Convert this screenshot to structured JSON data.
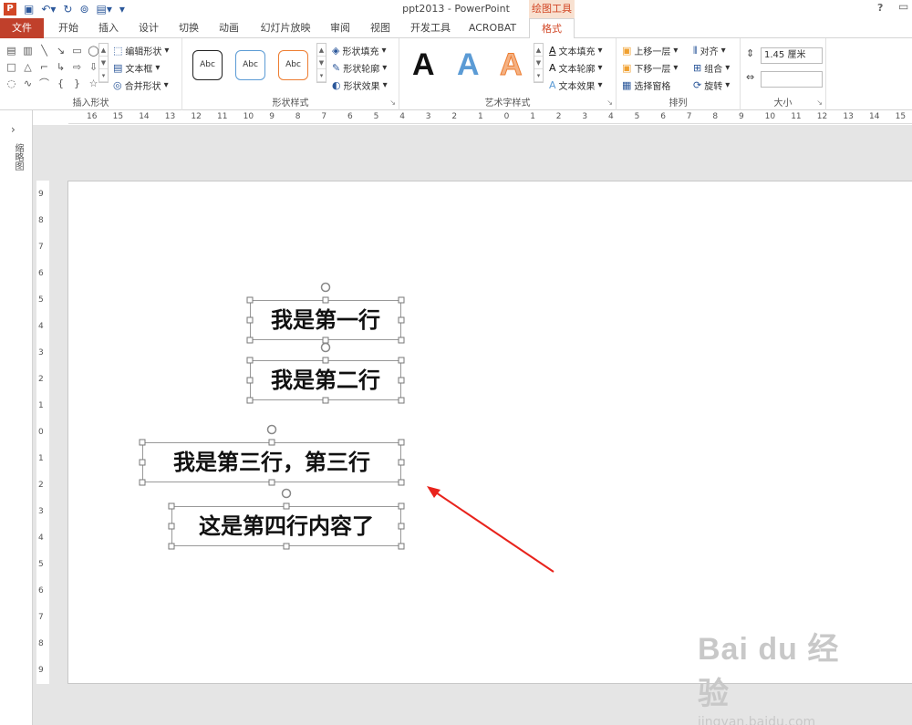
{
  "title": "ppt2013 - PowerPoint",
  "context_group": "绘图工具",
  "help": "?",
  "tabs": [
    "文件",
    "开始",
    "插入",
    "设计",
    "切换",
    "动画",
    "幻灯片放映",
    "审阅",
    "视图",
    "开发工具",
    "ACROBAT",
    "格式"
  ],
  "active_tab": "格式",
  "ribbon": {
    "insert_shapes": {
      "label": "插入形状",
      "edit_shape": "编辑形状",
      "text_box": "文本框",
      "merge_shapes": "合并形状"
    },
    "shape_styles": {
      "label": "形状样式",
      "style_sample": "Abc",
      "fill": "形状填充",
      "outline": "形状轮廓",
      "effects": "形状效果"
    },
    "wordart": {
      "label": "艺术字样式",
      "letter": "A",
      "text_fill": "文本填充",
      "text_outline": "文本轮廓",
      "text_effects": "文本效果"
    },
    "arrange": {
      "label": "排列",
      "bring_forward": "上移一层",
      "send_backward": "下移一层",
      "selection_pane": "选择窗格",
      "align": "对齐",
      "group": "组合",
      "rotate": "旋转"
    },
    "size": {
      "label": "大小",
      "height": "1.45 厘米",
      "width": ""
    }
  },
  "left_pane": {
    "label": "缩略图"
  },
  "ruler_h": [
    "16",
    "15",
    "14",
    "13",
    "12",
    "11",
    "10",
    "9",
    "8",
    "7",
    "6",
    "5",
    "4",
    "3",
    "2",
    "1",
    "0",
    "1",
    "2",
    "3",
    "4",
    "5",
    "6",
    "7",
    "8",
    "9",
    "10",
    "11",
    "12",
    "13",
    "14",
    "15",
    "16"
  ],
  "ruler_v": [
    "9",
    "8",
    "7",
    "6",
    "5",
    "4",
    "3",
    "2",
    "1",
    "0",
    "1",
    "2",
    "3",
    "4",
    "5",
    "6",
    "7",
    "8",
    "9"
  ],
  "slide": {
    "boxes": [
      "我是第一行",
      "我是第二行",
      "我是第三行，第三行",
      "这是第四行内容了"
    ],
    "arrow_color": "#e8231c"
  },
  "watermark": {
    "brand": "Bai du 经验",
    "url": "jingyan.baidu.com"
  }
}
